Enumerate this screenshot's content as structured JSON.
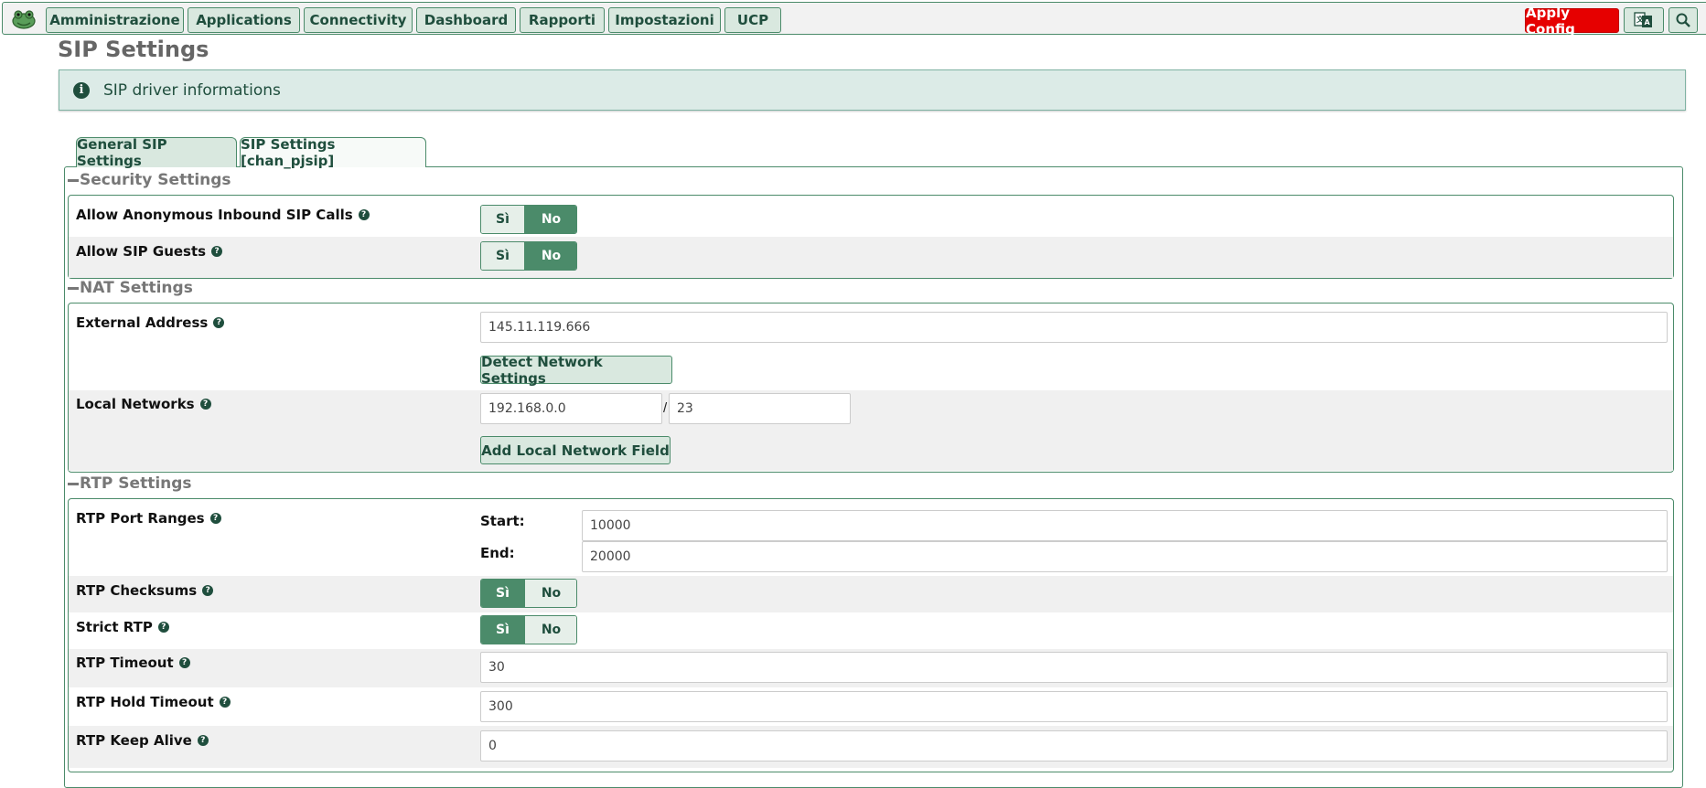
{
  "nav": {
    "items": [
      {
        "label": "Amministrazione"
      },
      {
        "label": "Applications"
      },
      {
        "label": "Connectivity"
      },
      {
        "label": "Dashboard"
      },
      {
        "label": "Rapporti"
      },
      {
        "label": "Impostazioni"
      },
      {
        "label": "UCP"
      }
    ],
    "apply_label": "Apply Config",
    "logo_icon": "frog-logo-icon",
    "translate_icon": "translate-icon",
    "search_icon": "search-icon"
  },
  "page": {
    "title": "SIP Settings",
    "info_text": "SIP driver informations"
  },
  "tabs": [
    {
      "label": "General SIP Settings",
      "active": true
    },
    {
      "label": "SIP Settings [chan_pjsip]",
      "active": false
    }
  ],
  "sections": {
    "security": {
      "title": "Security Settings",
      "anon_label": "Allow Anonymous Inbound SIP Calls",
      "guests_label": "Allow SIP Guests",
      "anon_value": "No",
      "guests_value": "No"
    },
    "nat": {
      "title": "NAT Settings",
      "external_label": "External Address",
      "external_value": "145.11.119.666",
      "detect_button": "Detect Network Settings",
      "local_label": "Local Networks",
      "local_ip": "192.168.0.0",
      "local_sep": "/",
      "local_mask": "23",
      "add_button": "Add Local Network Field"
    },
    "rtp": {
      "title": "RTP Settings",
      "port_label": "RTP Port Ranges",
      "start_label": "Start:",
      "start_value": "10000",
      "end_label": "End:",
      "end_value": "20000",
      "checksums_label": "RTP Checksums",
      "checksums_value": "Sì",
      "strict_label": "Strict RTP",
      "strict_value": "Sì",
      "timeout_label": "RTP Timeout",
      "timeout_value": "30",
      "hold_label": "RTP Hold Timeout",
      "hold_value": "300",
      "keepalive_label": "RTP Keep Alive",
      "keepalive_value": "0"
    }
  },
  "toggle": {
    "yes": "Sì",
    "no": "No"
  },
  "help_glyph": "?",
  "info_glyph": "i",
  "colors": {
    "accent": "#4b8b6a",
    "dark": "#1f4e3d",
    "apply": "#e60000",
    "banner": "#dcebe7"
  }
}
